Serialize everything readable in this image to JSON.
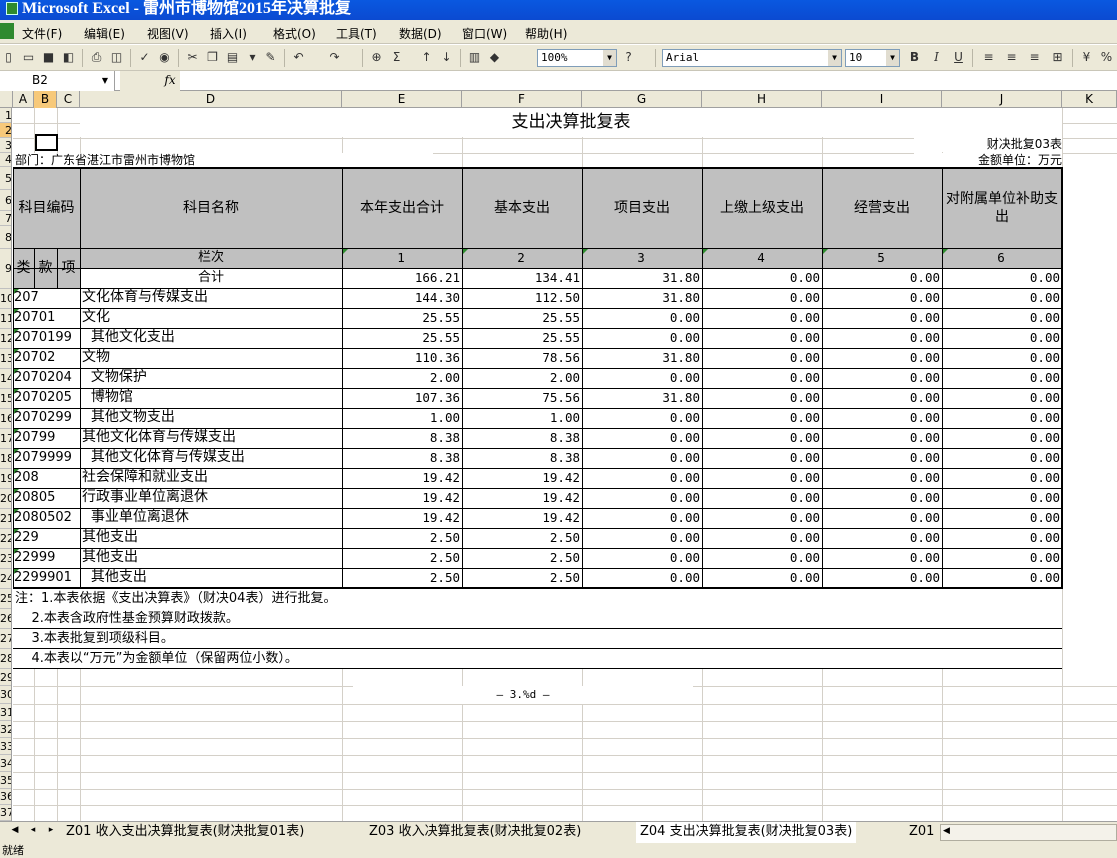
{
  "window": {
    "title": "Microsoft Excel - 雷州市博物馆2015年决算批复"
  },
  "menu": [
    "文件(F)",
    "编辑(E)",
    "视图(V)",
    "插入(I)",
    "格式(O)",
    "工具(T)",
    "数据(D)",
    "窗口(W)",
    "帮助(H)"
  ],
  "toolbar": {
    "zoom": "100%",
    "font": "Arial",
    "size": "10",
    "bold": "B",
    "italic": "I",
    "underline": "U"
  },
  "formula": {
    "namebox": "B2",
    "fx": "fx"
  },
  "columns": [
    "A",
    "B",
    "C",
    "D",
    "E",
    "F",
    "G",
    "H",
    "I",
    "J",
    "K"
  ],
  "rows": [
    "1",
    "2",
    "3",
    "4",
    "5",
    "6",
    "7",
    "8",
    "9",
    "10",
    "11",
    "12",
    "13",
    "14",
    "15",
    "16",
    "17",
    "18",
    "19",
    "20",
    "21",
    "22",
    "23",
    "24",
    "25",
    "26",
    "27",
    "28",
    "29",
    "30",
    "31",
    "32",
    "33",
    "34",
    "35",
    "36",
    "37"
  ],
  "sheet": {
    "title": "支出决算批复表",
    "code": "财决批复03表",
    "dept": "部门：广东省湛江市雷州市博物馆",
    "unit": "金额单位：万元",
    "headers": {
      "code": "科目编码",
      "name": "科目名称",
      "total": "本年支出合计",
      "basic": "基本支出",
      "project": "项目支出",
      "upper": "上缴上级支出",
      "business": "经营支出",
      "subsidy": "对附属单位补助支出",
      "lei": "类",
      "kuan": "款",
      "xiang": "项",
      "lanci": "栏次",
      "n1": "1",
      "n2": "2",
      "n3": "3",
      "n4": "4",
      "n5": "5",
      "n6": "6",
      "heji": "合计"
    },
    "total_row": [
      "166.21",
      "134.41",
      "31.80",
      "0.00",
      "0.00",
      "0.00"
    ],
    "rows": [
      {
        "code": "207",
        "name": "文化体育与传媒支出",
        "v": [
          "144.30",
          "112.50",
          "31.80",
          "0.00",
          "0.00",
          "0.00"
        ]
      },
      {
        "code": "20701",
        "name": "文化",
        "v": [
          "25.55",
          "25.55",
          "0.00",
          "0.00",
          "0.00",
          "0.00"
        ]
      },
      {
        "code": "2070199",
        "name": "  其他文化支出",
        "v": [
          "25.55",
          "25.55",
          "0.00",
          "0.00",
          "0.00",
          "0.00"
        ]
      },
      {
        "code": "20702",
        "name": "文物",
        "v": [
          "110.36",
          "78.56",
          "31.80",
          "0.00",
          "0.00",
          "0.00"
        ]
      },
      {
        "code": "2070204",
        "name": "  文物保护",
        "v": [
          "2.00",
          "2.00",
          "0.00",
          "0.00",
          "0.00",
          "0.00"
        ]
      },
      {
        "code": "2070205",
        "name": "  博物馆",
        "v": [
          "107.36",
          "75.56",
          "31.80",
          "0.00",
          "0.00",
          "0.00"
        ]
      },
      {
        "code": "2070299",
        "name": "  其他文物支出",
        "v": [
          "1.00",
          "1.00",
          "0.00",
          "0.00",
          "0.00",
          "0.00"
        ]
      },
      {
        "code": "20799",
        "name": "其他文化体育与传媒支出",
        "v": [
          "8.38",
          "8.38",
          "0.00",
          "0.00",
          "0.00",
          "0.00"
        ]
      },
      {
        "code": "2079999",
        "name": "  其他文化体育与传媒支出",
        "v": [
          "8.38",
          "8.38",
          "0.00",
          "0.00",
          "0.00",
          "0.00"
        ]
      },
      {
        "code": "208",
        "name": "社会保障和就业支出",
        "v": [
          "19.42",
          "19.42",
          "0.00",
          "0.00",
          "0.00",
          "0.00"
        ]
      },
      {
        "code": "20805",
        "name": "行政事业单位离退休",
        "v": [
          "19.42",
          "19.42",
          "0.00",
          "0.00",
          "0.00",
          "0.00"
        ]
      },
      {
        "code": "2080502",
        "name": "  事业单位离退休",
        "v": [
          "19.42",
          "19.42",
          "0.00",
          "0.00",
          "0.00",
          "0.00"
        ]
      },
      {
        "code": "229",
        "name": "其他支出",
        "v": [
          "2.50",
          "2.50",
          "0.00",
          "0.00",
          "0.00",
          "0.00"
        ]
      },
      {
        "code": "22999",
        "name": "其他支出",
        "v": [
          "2.50",
          "2.50",
          "0.00",
          "0.00",
          "0.00",
          "0.00"
        ]
      },
      {
        "code": "2299901",
        "name": "  其他支出",
        "v": [
          "2.50",
          "2.50",
          "0.00",
          "0.00",
          "0.00",
          "0.00"
        ]
      }
    ],
    "notes": [
      "注：1.本表依据《支出决算表》（财决04表）进行批复。",
      "    2.本表含政府性基金预算财政拨款。",
      "    3.本表批复到项级科目。",
      "    4.本表以“万元”为金额单位（保留两位小数）。"
    ],
    "footer": "— 3.%d —"
  },
  "tabs": [
    "Z01 收入支出决算批复表(财决批复01表)",
    "Z03 收入决算批复表(财决批复02表)",
    "Z04 支出决算批复表(财决批复03表)",
    "Z01"
  ],
  "status": "就绪"
}
